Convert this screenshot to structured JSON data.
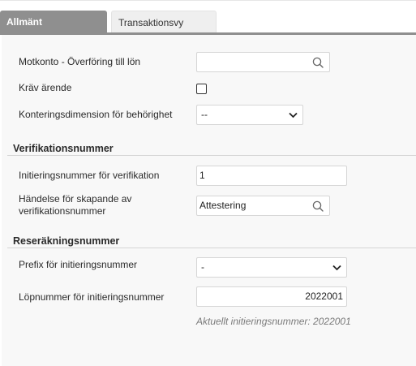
{
  "tabs": [
    {
      "label": "Allmänt",
      "active": true
    },
    {
      "label": "Transaktionsvy",
      "active": false
    }
  ],
  "general": {
    "counter_account_label": "Motkonto - Överföring till lön",
    "counter_account_value": "",
    "require_case_label": "Kräv ärende",
    "require_case_checked": false,
    "dimension_label": "Konteringsdimension för behörighet",
    "dimension_value": "--"
  },
  "verification": {
    "section_title": "Verifikationsnummer",
    "init_number_label": "Initieringsnummer för verifikation",
    "init_number_value": "1",
    "event_label_line1": "Händelse för skapande av",
    "event_label_line2": "verifikationsnummer",
    "event_value": "Attestering"
  },
  "expense": {
    "section_title": "Reseräkningsnummer",
    "prefix_label": "Prefix för initieringsnummer",
    "prefix_value": "-",
    "serial_label": "Löpnummer för initieringsnummer",
    "serial_value": "2022001",
    "current_hint": "Aktuellt initieringsnummer: 2022001"
  },
  "icons": {
    "search": "search-icon",
    "dropdown": "chevron-down-icon",
    "checkbox": "checkbox"
  },
  "colors": {
    "active_tab": "#8f8f8f",
    "panel_bg": "#f8f8f8"
  }
}
